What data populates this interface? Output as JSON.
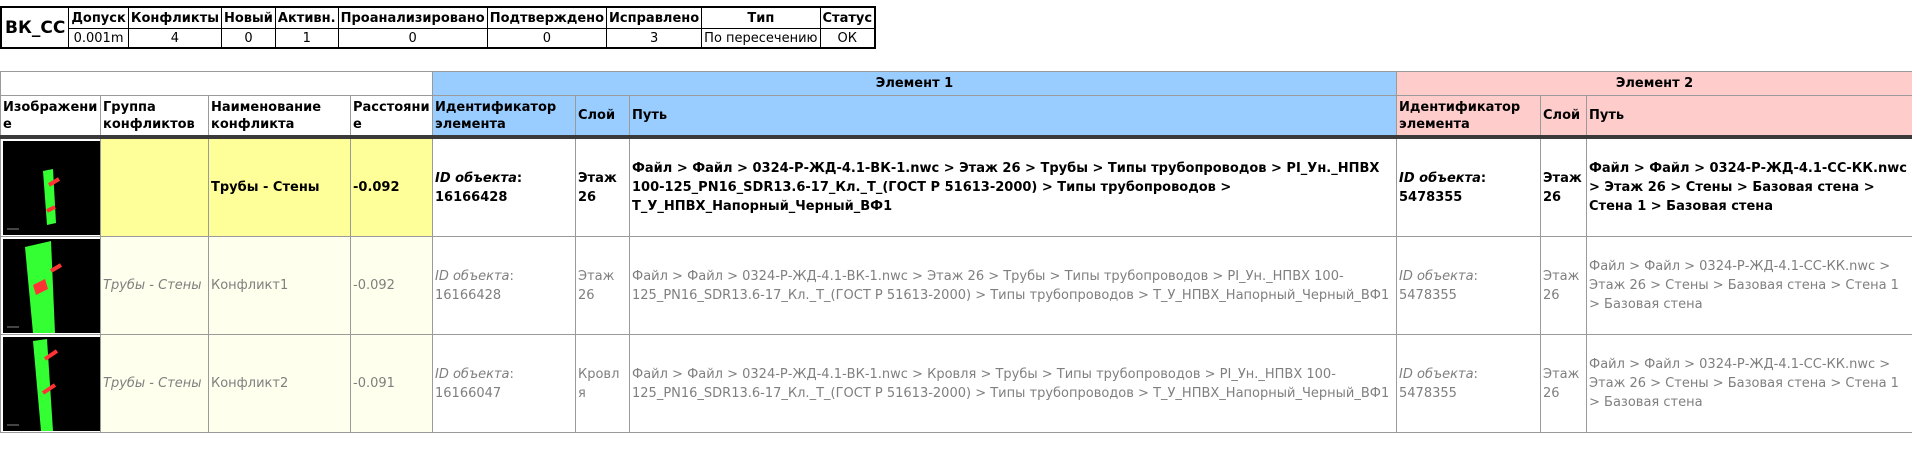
{
  "summary": {
    "test_name": "ВК_СС",
    "headers": [
      "Допуск",
      "Конфликты",
      "Новый",
      "Активн.",
      "Проанализировано",
      "Подтверждено",
      "Исправлено",
      "Тип",
      "Статус"
    ],
    "values": [
      "0.001m",
      "4",
      "0",
      "1",
      "0",
      "0",
      "3",
      "По пересечению",
      "ОК"
    ]
  },
  "groups": {
    "element1": "Элемент 1",
    "element2": "Элемент 2"
  },
  "columns": {
    "image": "Изображение",
    "group": "Группа конфликтов",
    "name": "Наименование конфликта",
    "distance": "Расстояние",
    "e1_id": "Идентификатор элемента",
    "e1_layer": "Слой",
    "e1_path": "Путь",
    "e2_id": "Идентификатор элемента",
    "e2_layer": "Слой",
    "e2_path": "Путь"
  },
  "id_label": "ID объекта",
  "rows": [
    {
      "group": "",
      "name": "Трубы - Стены",
      "distance": "-0.092",
      "e1_id": "16166428",
      "e1_layer": "Этаж 26",
      "e1_path": "Файл > Файл > 0324-Р-ЖД-4.1-ВК-1.nwc > Этаж 26 > Трубы > Типы трубопроводов > PI_Ун._НПВХ 100-125_PN16_SDR13.6-17_Кл._Т_(ГОСТ Р 51613-2000) > Типы трубопроводов > Т_У_НПВХ_Напорный_Черный_ВФ1",
      "e2_id": "5478355",
      "e2_layer": "Этаж 26",
      "e2_path": "Файл > Файл > 0324-Р-ЖД-4.1-СС-КК.nwc > Этаж 26 > Стены > Базовая стена > Стена 1 > Базовая стена"
    },
    {
      "group": "Трубы - Стены",
      "name": "Конфликт1",
      "distance": "-0.092",
      "e1_id": "16166428",
      "e1_layer": "Этаж 26",
      "e1_path": "Файл > Файл > 0324-Р-ЖД-4.1-ВК-1.nwc > Этаж 26 > Трубы > Типы трубопроводов > PI_Ун._НПВХ 100-125_PN16_SDR13.6-17_Кл._Т_(ГОСТ Р 51613-2000) > Типы трубопроводов > Т_У_НПВХ_Напорный_Черный_ВФ1",
      "e2_id": "5478355",
      "e2_layer": "Этаж 26",
      "e2_path": "Файл > Файл > 0324-Р-ЖД-4.1-СС-КК.nwc > Этаж 26 > Стены > Базовая стена > Стена 1 > Базовая стена"
    },
    {
      "group": "Трубы - Стены",
      "name": "Конфликт2",
      "distance": "-0.091",
      "e1_id": "16166047",
      "e1_layer": "Кровля",
      "e1_path": "Файл > Файл > 0324-Р-ЖД-4.1-ВК-1.nwc > Кровля > Трубы > Типы трубопроводов > PI_Ун._НПВХ 100-125_PN16_SDR13.6-17_Кл._Т_(ГОСТ Р 51613-2000) > Типы трубопроводов > Т_У_НПВХ_Напорный_Черный_ВФ1",
      "e2_id": "5478355",
      "e2_layer": "Этаж 26",
      "e2_path": "Файл > Файл > 0324-Р-ЖД-4.1-СС-КК.nwc > Этаж 26 > Стены > Базовая стена > Стена 1 > Базовая стена"
    }
  ],
  "colors": {
    "element1_header": "#99ccff",
    "element2_header": "#ffcccc",
    "group_row_highlight": "#ffff99",
    "item_row_highlight": "#ffffee",
    "wall_green": "#33ff33",
    "pipe_red": "#ff3333"
  }
}
